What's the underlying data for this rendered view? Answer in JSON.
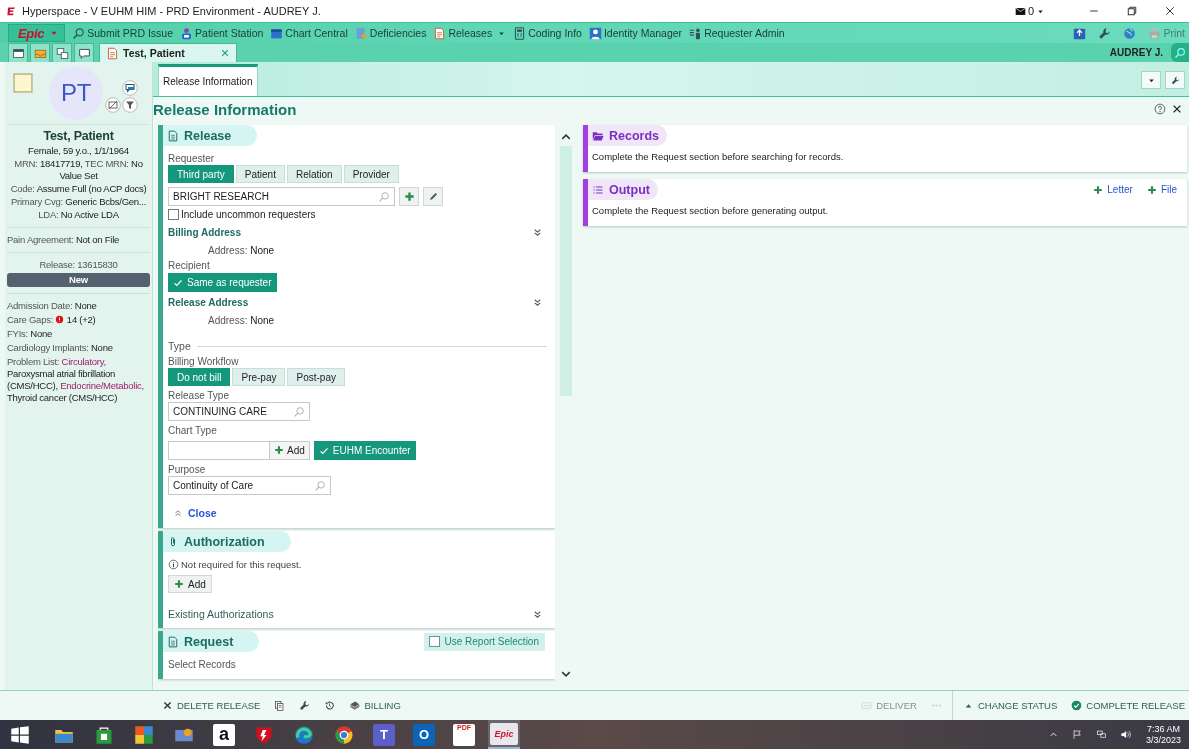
{
  "window": {
    "title": "Hyperspace - V EUHM HIM - PRD Environment - AUDREY J.",
    "mail_count": "0"
  },
  "toolbar": {
    "menu_label": "Epic",
    "items": [
      {
        "label": "Submit PRD Issue",
        "kind": "search",
        "has_menu": false
      },
      {
        "label": "Patient Station",
        "kind": "station",
        "has_menu": false
      },
      {
        "label": "Chart Central",
        "kind": "calendar",
        "has_menu": false
      },
      {
        "label": "Deficiencies",
        "kind": "deficiency",
        "has_menu": false
      },
      {
        "label": "Releases",
        "kind": "release",
        "has_menu": true
      },
      {
        "label": "Coding Info",
        "kind": "calculator",
        "has_menu": false
      },
      {
        "label": "Identity Manager",
        "kind": "person",
        "has_menu": false
      },
      {
        "label": "Requester Admin",
        "kind": "people",
        "has_menu": false
      }
    ],
    "right_tools": [
      {
        "kind": "upload",
        "disabled": false
      },
      {
        "kind": "wrench",
        "disabled": false
      },
      {
        "kind": "globe",
        "disabled": false
      },
      {
        "kind": "print",
        "label": "Print",
        "disabled": true
      }
    ]
  },
  "workspace": {
    "tools": [
      {
        "kind": "window"
      },
      {
        "kind": "tray"
      },
      {
        "kind": "stack"
      },
      {
        "kind": "chat"
      }
    ],
    "tabs": [
      {
        "label": "Test, Patient",
        "selected": true
      }
    ],
    "user": "AUDREY J."
  },
  "patient": {
    "initials": "PT",
    "name": "Test, Patient",
    "summary": [
      [
        {
          "text": "Female, 59 y.o., 1/1/1964",
          "kind": "value"
        }
      ],
      [
        {
          "text": "MRN:",
          "kind": "label"
        },
        {
          "text": "18417719,",
          "kind": "value"
        },
        {
          "text": "TEC MRN:",
          "kind": "label"
        },
        {
          "text": "No Value Set",
          "kind": "value"
        }
      ],
      [
        {
          "text": "Code:",
          "kind": "label"
        },
        {
          "text": "Assume Full (no ACP docs)",
          "kind": "value"
        }
      ],
      [
        {
          "text": "Primary Cvg:",
          "kind": "label"
        },
        {
          "text": "Generic Bcbs/Gen...",
          "kind": "value"
        }
      ],
      [
        {
          "text": "LDA:",
          "kind": "label"
        },
        {
          "text": "No Active LDA",
          "kind": "value"
        }
      ]
    ],
    "pain_agreement": [
      {
        "text": "Pain Agreement:",
        "kind": "label"
      },
      {
        "text": "Not on File",
        "kind": "value"
      }
    ],
    "release_label": "Release: 13615830",
    "release_status": "New",
    "details": [
      [
        {
          "text": "Admission Date:",
          "kind": "label"
        },
        {
          "text": "None",
          "kind": "value"
        }
      ],
      [
        {
          "text": "Care Gaps:",
          "kind": "label"
        },
        {
          "kind": "alert"
        },
        {
          "text": "14 (+2)",
          "kind": "value"
        }
      ],
      [
        {
          "text": "FYIs:",
          "kind": "label"
        },
        {
          "text": "None",
          "kind": "value"
        }
      ],
      [
        {
          "text": "Cardiology Implants:",
          "kind": "label"
        },
        {
          "text": "None",
          "kind": "value"
        }
      ],
      [
        {
          "text": "Problem List:",
          "kind": "label"
        },
        {
          "text": "Circulatory,",
          "kind": "category"
        },
        {
          "text": "Paroxysmal atrial fibrillation (CMS/HCC),",
          "kind": "value"
        },
        {
          "text": "Endocrine/Metabolic,",
          "kind": "category"
        },
        {
          "text": "Thyroid cancer (CMS/HCC)",
          "kind": "value"
        }
      ]
    ]
  },
  "activity_tabs": [
    {
      "label": "Release Information",
      "selected": true
    }
  ],
  "page_title": "Release Information",
  "release_section": {
    "title": "Release",
    "requester_label": "Requester",
    "requester_options": [
      {
        "label": "Third party",
        "selected": true
      },
      {
        "label": "Patient",
        "selected": false
      },
      {
        "label": "Relation",
        "selected": false
      },
      {
        "label": "Provider",
        "selected": false
      }
    ],
    "requester_value": "BRIGHT RESEARCH",
    "uncommon": {
      "label": "Include uncommon requesters",
      "checked": false
    },
    "billing_address": {
      "title": "Billing Address",
      "label": "Address:",
      "value": "None"
    },
    "recipient_label": "Recipient",
    "recipient_choice": {
      "label": "Same as requester",
      "checked": true
    },
    "release_address": {
      "title": "Release Address",
      "label": "Address:",
      "value": "None"
    },
    "type_heading": "Type",
    "workflow_label": "Billing Workflow",
    "workflow_options": [
      {
        "label": "Do not bill",
        "selected": true
      },
      {
        "label": "Pre-pay",
        "selected": false
      },
      {
        "label": "Post-pay",
        "selected": false
      }
    ],
    "release_type_label": "Release Type",
    "release_type_value": "CONTINUING CARE",
    "chart_type_label": "Chart Type",
    "chart_add": "Add",
    "chart_chip": {
      "label": "EUHM Encounter",
      "checked": true
    },
    "purpose_label": "Purpose",
    "purpose_value": "Continuity of Care",
    "close": "Close"
  },
  "authorization_section": {
    "title": "Authorization",
    "note": "Not required for this request.",
    "add": "Add",
    "existing": "Existing Authorizations"
  },
  "request_section": {
    "title": "Request",
    "report_selection": {
      "label": "Use Report Selection",
      "checked": false
    },
    "select_label": "Select Records"
  },
  "records_section": {
    "title": "Records",
    "message": "Complete the Request section before searching for records."
  },
  "output_section": {
    "title": "Output",
    "actions": [
      "Letter",
      "File"
    ],
    "message": "Complete the Request section before generating output."
  },
  "action_bar": {
    "left": [
      {
        "kind": "delete",
        "label": "DELETE RELEASE",
        "disabled": false
      },
      {
        "kind": "copy",
        "disabled": false
      },
      {
        "kind": "wrench",
        "disabled": false
      },
      {
        "kind": "history",
        "disabled": false
      },
      {
        "kind": "billing",
        "label": "BILLING",
        "disabled": false
      }
    ],
    "right": [
      {
        "kind": "deliver",
        "label": "DELIVER",
        "disabled": true
      },
      {
        "kind": "more",
        "disabled": true
      },
      {
        "kind": "status",
        "label": "CHANGE STATUS",
        "disabled": false
      },
      {
        "kind": "complete",
        "label": "COMPLETE RELEASE",
        "disabled": false
      }
    ]
  },
  "taskbar": {
    "apps": [
      {
        "kind": "start",
        "active": false
      },
      {
        "kind": "explorer",
        "active": false
      },
      {
        "kind": "store",
        "active": false
      },
      {
        "kind": "puzzle",
        "active": false
      },
      {
        "kind": "media",
        "active": false
      },
      {
        "kind": "amazon",
        "glyph": "a",
        "active": false
      },
      {
        "kind": "shield",
        "active": false
      },
      {
        "kind": "edge",
        "active": false
      },
      {
        "kind": "chrome",
        "active": false
      },
      {
        "kind": "teams",
        "glyph": "T",
        "active": false
      },
      {
        "kind": "outlook",
        "glyph": "O",
        "active": false
      },
      {
        "kind": "pdf",
        "glyph": "PDF",
        "active": false
      },
      {
        "kind": "epic",
        "glyph": "Epic",
        "active": true
      }
    ],
    "time": "7:36 AM",
    "date": "3/3/2023"
  }
}
